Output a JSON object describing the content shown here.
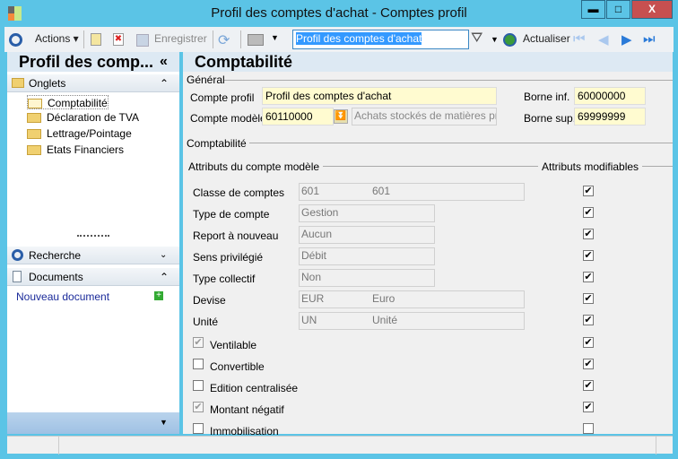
{
  "window": {
    "title": "Profil des comptes d'achat -  Comptes profil",
    "minimize": "▬",
    "maximize": "□",
    "close": "X"
  },
  "toolbar": {
    "actions": "Actions ▾",
    "save": "Enregistrer",
    "search_value": "Profil des comptes d'achat",
    "refresh": "Actualiser"
  },
  "left": {
    "title": "Profil des comp...",
    "collapse": "«",
    "onglets": "Onglets",
    "tree": [
      "Comptabilité",
      "Déclaration de TVA",
      "Lettrage/Pointage",
      "Etats Financiers"
    ],
    "recherche": "Recherche",
    "documents": "Documents",
    "new_doc": "Nouveau document"
  },
  "main": {
    "title": "Comptabilité",
    "general": "Général",
    "compte_profil_label": "Compte profil",
    "compte_profil": "Profil des comptes d'achat",
    "compte_modele_label": "Compte modèle",
    "compte_modele": "60110000",
    "compte_modele_desc": "Achats stockés de matières pre",
    "borne_inf_label": "Borne inf.",
    "borne_inf": "60000000",
    "borne_sup_label": "Borne sup.",
    "borne_sup": "69999999",
    "comptabilite": "Comptabilité",
    "attr_modele": "Attributs du compte modèle",
    "attr_modif": "Attributs modifiables",
    "fields": [
      {
        "label": "Classe de comptes",
        "v1": "601",
        "v2": "601",
        "wide": true,
        "modifiable": true
      },
      {
        "label": "Type de compte",
        "v1": "Gestion",
        "v2": "",
        "wide": false,
        "modifiable": true
      },
      {
        "label": "Report à nouveau",
        "v1": "Aucun",
        "v2": "",
        "wide": false,
        "modifiable": true
      },
      {
        "label": "Sens privilégié",
        "v1": "Débit",
        "v2": "",
        "wide": false,
        "modifiable": true
      },
      {
        "label": "Type collectif",
        "v1": "Non",
        "v2": "",
        "wide": false,
        "modifiable": true
      },
      {
        "label": "Devise",
        "v1": "EUR",
        "v2": "Euro",
        "wide": true,
        "modifiable": true
      },
      {
        "label": "Unité",
        "v1": "UN",
        "v2": "Unité",
        "wide": true,
        "modifiable": true
      }
    ],
    "checks": [
      {
        "label": "Ventilable",
        "checked": true,
        "disabled": true,
        "modifiable": true
      },
      {
        "label": "Convertible",
        "checked": false,
        "disabled": false,
        "modifiable": true
      },
      {
        "label": "Edition centralisée",
        "checked": false,
        "disabled": false,
        "modifiable": true
      },
      {
        "label": "Montant négatif",
        "checked": true,
        "disabled": true,
        "modifiable": true
      },
      {
        "label": "Immobilisation",
        "checked": false,
        "disabled": false,
        "modifiable": false
      }
    ]
  }
}
